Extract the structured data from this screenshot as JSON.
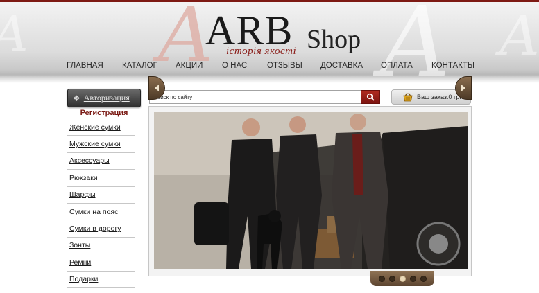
{
  "header": {
    "logo_main": "ARB",
    "logo_shop": "Shop",
    "logo_tagline": "історія якості",
    "decor_letter": "A"
  },
  "nav": {
    "items": [
      "ГЛАВНАЯ",
      "КАТАЛОГ",
      "АКЦИИ",
      "О НАС",
      "ОТЗЫВЫ",
      "ДОСТАВКА",
      "ОПЛАТА",
      "КОНТАКТЫ"
    ]
  },
  "sidebar": {
    "auth_label": "Авторизация",
    "register_label": "Регистрация",
    "menu": [
      "Женские сумки",
      "Мужские сумки",
      "Аксессуары",
      "Рюкзаки",
      "Шарфы",
      "Сумки на пояс",
      "Сумки в дорогу",
      "Зонты",
      "Ремни",
      "Подарки"
    ]
  },
  "search": {
    "placeholder": "Поиск по сайту"
  },
  "cart": {
    "label": "Ваш заказ:0 грн."
  },
  "slider": {
    "dot_count": 5,
    "active_dot": 3
  },
  "colors": {
    "accent": "#7a1a14",
    "header_top_bar": "#7e1a14",
    "slider_controls": "#6b5139"
  }
}
